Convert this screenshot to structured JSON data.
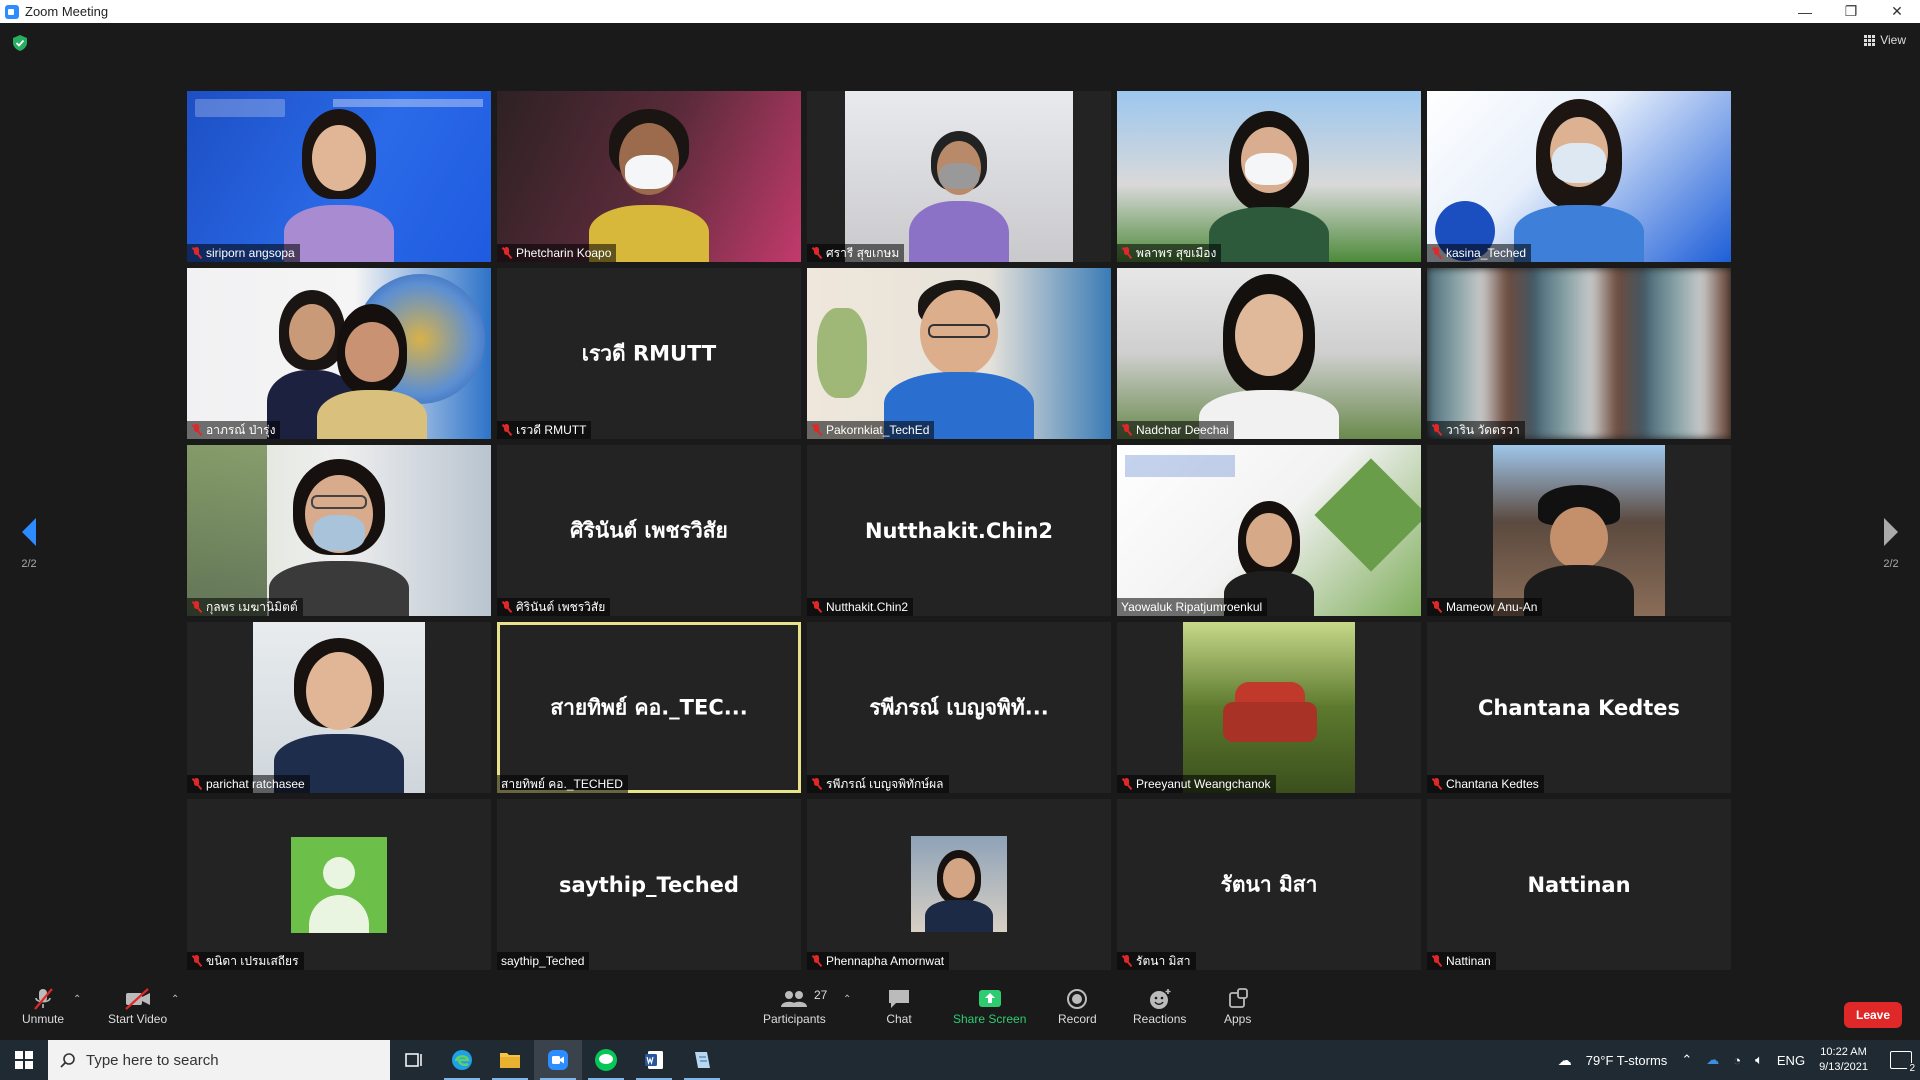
{
  "window": {
    "title": "Zoom Meeting",
    "controls": [
      "—",
      "❐",
      "✕"
    ]
  },
  "view": {
    "label": "View"
  },
  "pager": {
    "left_label": "2/2",
    "right_label": "2/2"
  },
  "participants": [
    {
      "label": "siriporn angsopa",
      "muted": true
    },
    {
      "label": "Phetcharin Koapo",
      "muted": true
    },
    {
      "label": "ศรารี สุขเกษม",
      "muted": true
    },
    {
      "label": "พลาพร สุขเมือง",
      "muted": true
    },
    {
      "label": "kasina_Teched",
      "muted": true
    },
    {
      "label": "อาภรณ์ ป่ารุ่ง",
      "muted": true
    },
    {
      "label": "เรวดี RMUTT",
      "muted": true,
      "big": "เรวดี RMUTT"
    },
    {
      "label": "Pakornkiat_TechEd",
      "muted": true
    },
    {
      "label": "Nadchar Deechai",
      "muted": true
    },
    {
      "label": "วาริน วัดตรวา",
      "muted": true
    },
    {
      "label": "กุลพร เมฆานิมิตต์",
      "muted": true
    },
    {
      "label": "ศิรินันต์ เพชรวิสัย",
      "muted": true,
      "big": "ศิรินันต์ เพชรวิสัย"
    },
    {
      "label": "Nutthakit.Chin2",
      "muted": true,
      "big": "Nutthakit.Chin2"
    },
    {
      "label": "Yaowaluk Ripatjumroenkul",
      "muted": false
    },
    {
      "label": "Mameow Anu-An",
      "muted": true
    },
    {
      "label": "parichat ratchasee",
      "muted": true
    },
    {
      "label": "สายทิพย์ คอ._TECHED",
      "muted": false,
      "big": "สายทิพย์ คอ._TEC..."
    },
    {
      "label": "รพีภรณ์ เบญจพิทักษ์ผล",
      "muted": true,
      "big": "รพีภรณ์ เบญจพิทั..."
    },
    {
      "label": "Preeyanut Weangchanok",
      "muted": true
    },
    {
      "label": "Chantana Kedtes",
      "muted": true,
      "big": "Chantana Kedtes"
    },
    {
      "label": "ขนิดา เปรมเสถียร",
      "muted": true
    },
    {
      "label": "saythip_Teched",
      "muted": false,
      "big": "saythip_Teched"
    },
    {
      "label": "Phennapha Amornwat",
      "muted": true
    },
    {
      "label": "รัตนา มิสา",
      "muted": true,
      "big": "รัตนา มิสา"
    },
    {
      "label": "Nattinan",
      "muted": true,
      "big": "Nattinan"
    }
  ],
  "toolbar": {
    "unmute": "Unmute",
    "start_video": "Start Video",
    "participants": "Participants",
    "participants_count": "27",
    "chat": "Chat",
    "share_screen": "Share Screen",
    "record": "Record",
    "reactions": "Reactions",
    "apps": "Apps",
    "leave": "Leave"
  },
  "taskbar": {
    "search_placeholder": "Type here to search",
    "weather": "79°F  T-storms",
    "language": "ENG",
    "time": "10:22 AM",
    "date": "9/13/2021",
    "notifications": "2"
  },
  "colors": {
    "accent": "#2d8cff",
    "share": "#2ecc71",
    "leave": "#e02828",
    "active_speaker": "#e8e38a"
  }
}
